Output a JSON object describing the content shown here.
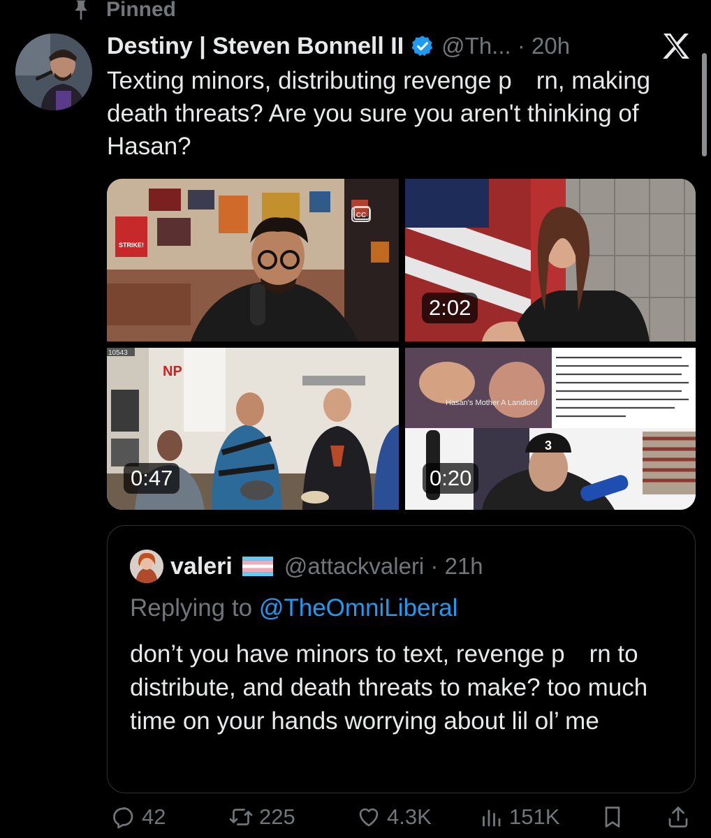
{
  "pinned_label": "Pinned",
  "tweet": {
    "author_name": "Destiny | Steven Bonnell II",
    "handle_time": "@Th... · 20h",
    "text": "Texting minors, distributing revenge p rn, making death threats? Are you sure you aren't thinking of Hasan?"
  },
  "media": [
    {
      "duration": ""
    },
    {
      "duration": "2:02"
    },
    {
      "duration": "0:47"
    },
    {
      "duration": "0:20"
    }
  ],
  "media_captions": {
    "tile1_sign": "STRIKE!",
    "tile2_counter": "10543",
    "tile4_overlay": "Hasan's Mother A Landlord",
    "tile4_cap": "3"
  },
  "quote": {
    "author_name": "valeri",
    "handle_time": "@attackvaleri · 21h",
    "replying_prefix": "Replying to ",
    "replying_mention": "@TheOmniLiberal",
    "text": "don’t you have minors to text, revenge p rn to distribute, and death threats to make? too much time on your hands worrying about lil ol’ me"
  },
  "stats": {
    "replies": "42",
    "retweets": "225",
    "likes": "4.3K",
    "views": "151K"
  },
  "colors": {
    "background": "#000000",
    "text": "#e7e9ea",
    "secondary": "#71767b",
    "accent": "#1d9bf0",
    "border": "#2f3336"
  },
  "icons": [
    "pin-icon",
    "verified-badge-icon",
    "x-logo-icon",
    "closed-captions-icon",
    "trans-flag-icon",
    "reply-icon",
    "retweet-icon",
    "like-icon",
    "views-icon",
    "bookmark-icon",
    "share-icon"
  ]
}
